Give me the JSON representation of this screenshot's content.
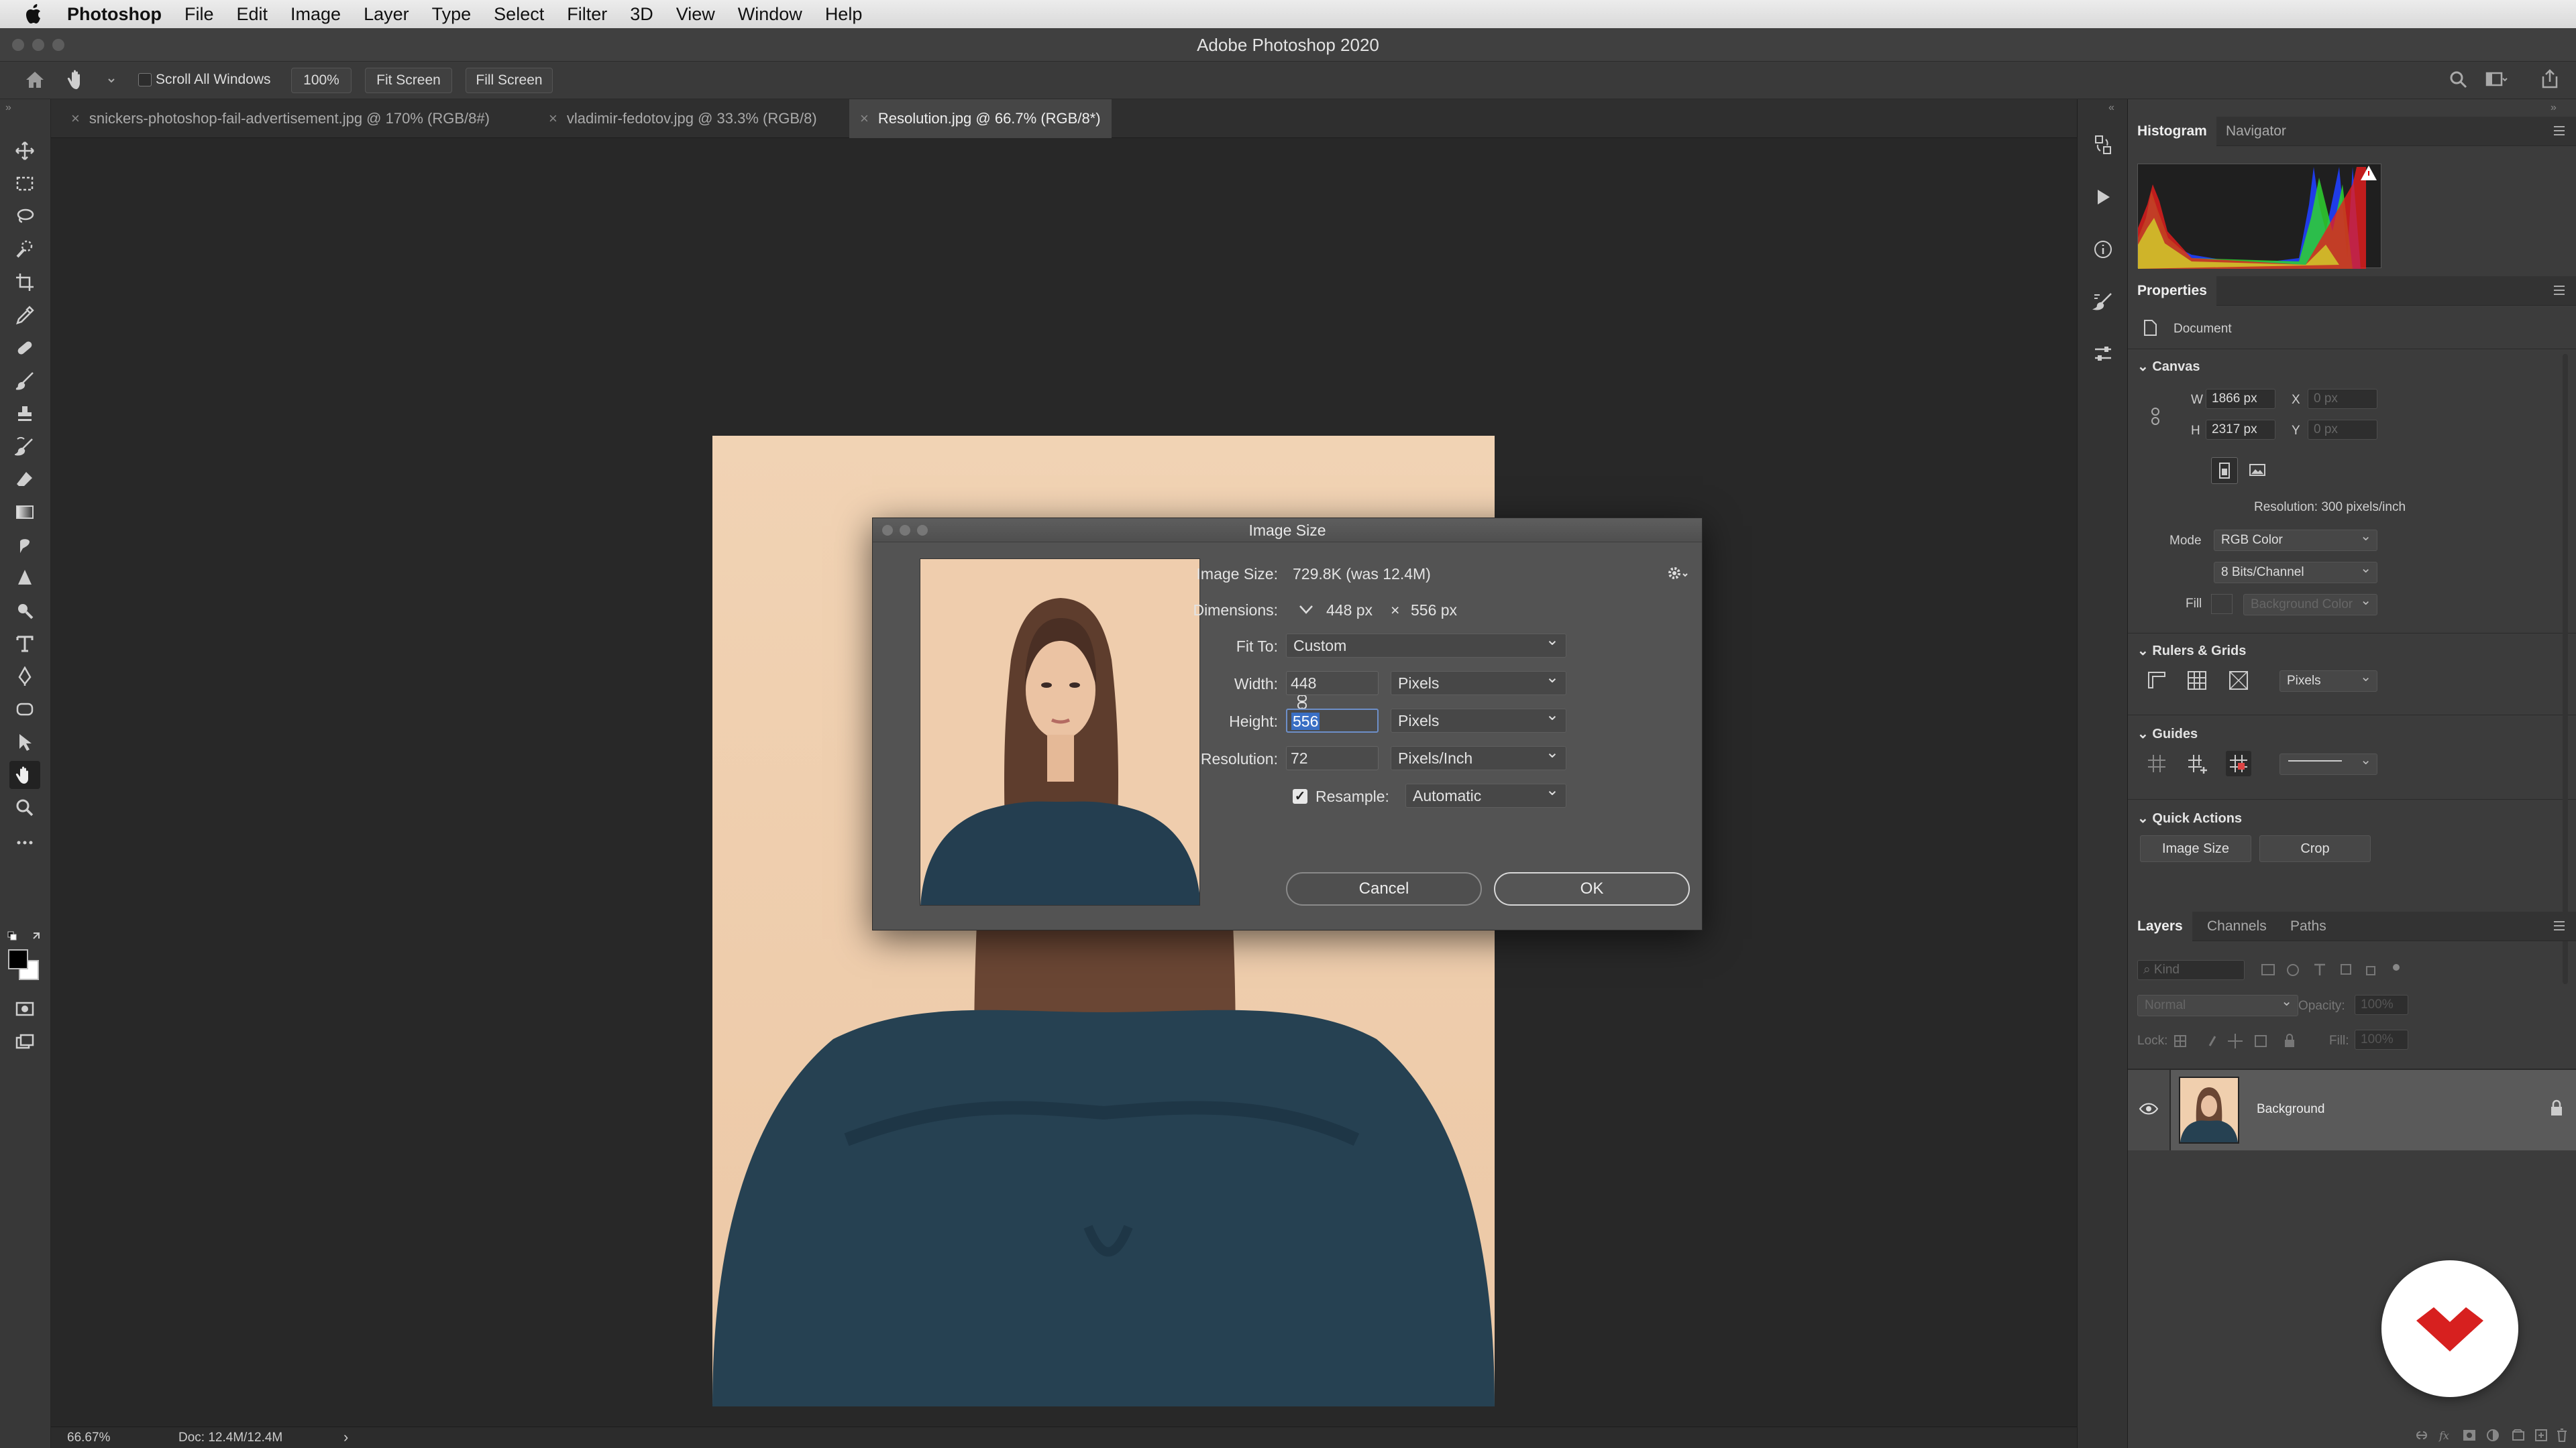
{
  "menubar": {
    "app_name": "Photoshop",
    "items": [
      "File",
      "Edit",
      "Image",
      "Layer",
      "Type",
      "Select",
      "Filter",
      "3D",
      "View",
      "Window",
      "Help"
    ]
  },
  "window": {
    "title": "Adobe Photoshop 2020"
  },
  "options_bar": {
    "scroll_all_windows": "Scroll All Windows",
    "zoom_100": "100%",
    "fit_screen": "Fit Screen",
    "fill_screen": "Fill Screen"
  },
  "tabs": [
    {
      "label": "snickers-photoshop-fail-advertisement.jpg @ 170% (RGB/8#)"
    },
    {
      "label": "vladimir-fedotov.jpg @ 33.3% (RGB/8)"
    },
    {
      "label": "Resolution.jpg @ 66.7% (RGB/8*)"
    }
  ],
  "status": {
    "zoom": "66.67%",
    "doc": "Doc: 12.4M/12.4M",
    "arrow": "›"
  },
  "dialog": {
    "title": "Image Size",
    "image_size_label": "Image Size:",
    "image_size_value": "729.8K (was 12.4M)",
    "dimensions_label": "Dimensions:",
    "dimensions_w": "448 px",
    "dimensions_x": "×",
    "dimensions_h": "556 px",
    "fit_to_label": "Fit To:",
    "fit_to_value": "Custom",
    "width_label": "Width:",
    "width_value": "448",
    "width_unit": "Pixels",
    "height_label": "Height:",
    "height_value": "556",
    "height_unit": "Pixels",
    "resolution_label": "Resolution:",
    "resolution_value": "72",
    "resolution_unit": "Pixels/Inch",
    "resample_label": "Resample:",
    "resample_value": "Automatic",
    "cancel": "Cancel",
    "ok": "OK"
  },
  "panels": {
    "top_tabs": [
      "Histogram",
      "Navigator"
    ],
    "properties": {
      "title": "Properties",
      "document": "Document",
      "canvas": "Canvas",
      "w_label": "W",
      "w_value": "1866 px",
      "h_label": "H",
      "h_value": "2317 px",
      "x_label": "X",
      "x_value": "0 px",
      "y_label": "Y",
      "y_value": "0 px",
      "resolution": "Resolution: 300 pixels/inch",
      "mode_label": "Mode",
      "mode_value": "RGB Color",
      "bits_value": "8 Bits/Channel",
      "fill_label": "Fill",
      "fill_value": "Background Color",
      "rulers_grids": "Rulers & Grids",
      "rulers_unit": "Pixels",
      "guides": "Guides",
      "quick_actions": "Quick Actions",
      "image_size_btn": "Image Size",
      "crop_btn": "Crop"
    },
    "layers": {
      "tabs": [
        "Layers",
        "Channels",
        "Paths"
      ],
      "kind": "Kind",
      "blend": "Normal",
      "opacity_label": "Opacity:",
      "opacity_value": "100%",
      "lock_label": "Lock:",
      "fill_label": "Fill:",
      "fill_value": "100%",
      "layer_name": "Background"
    }
  },
  "colors": {
    "accent": "#3a6fc4",
    "brand_badge": "#d7201f"
  }
}
